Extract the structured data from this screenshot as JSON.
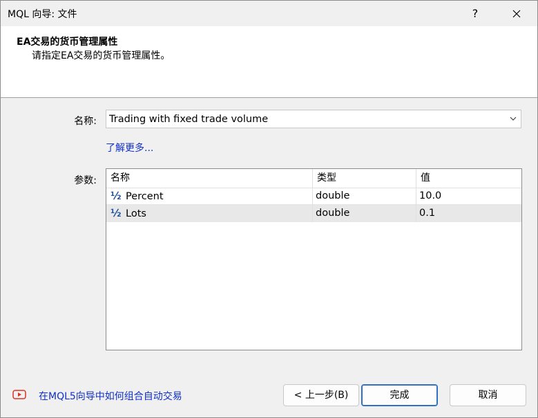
{
  "window": {
    "title": "MQL 向导: 文件",
    "help_glyph": "?",
    "close_icon": "close-icon"
  },
  "header": {
    "title": "EA交易的货币管理属性",
    "subtitle": "请指定EA交易的货币管理属性。"
  },
  "form": {
    "name_label": "名称:",
    "name_value": "Trading with fixed trade volume",
    "learn_more": "了解更多...",
    "params_label": "参数:"
  },
  "table": {
    "columns": [
      "名称",
      "类型",
      "值"
    ],
    "rows": [
      {
        "icon": "½",
        "name": "Percent",
        "type": "double",
        "value": "10.0"
      },
      {
        "icon": "½",
        "name": "Lots",
        "type": "double",
        "value": "0.1"
      }
    ],
    "selected_row": 1
  },
  "footer": {
    "video_link": "在MQL5向导中如何组合自动交易",
    "back_label": "< 上一步(B)",
    "finish_label": "完成",
    "cancel_label": "取消"
  },
  "colors": {
    "link": "#0f2fc8",
    "video_icon": "#e0301e",
    "default_button_border": "#2f6fc4"
  }
}
